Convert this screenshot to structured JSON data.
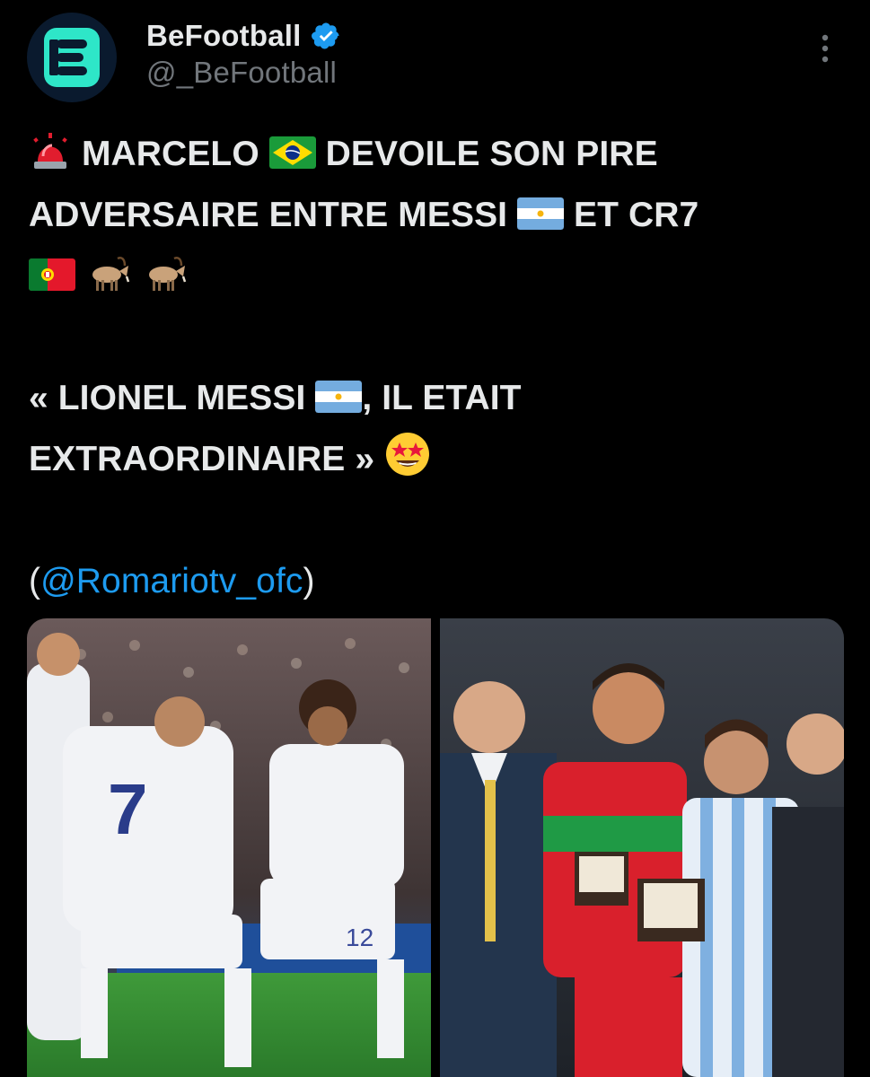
{
  "account": {
    "display_name": "BeFootball",
    "handle": "@_BeFootball",
    "verified": true,
    "avatar_icon": "befootball-logo",
    "brand_color": "#2ee6c8"
  },
  "header": {
    "more_icon": "more-vertical-icon"
  },
  "post": {
    "line1_a": "MARCELO",
    "line1_b": "DEVOILE SON PIRE",
    "line2_a": "ADVERSAIRE ENTRE MESSI",
    "line2_b": "ET CR7",
    "quote_line1_a": "« LIONEL MESSI",
    "quote_line1_b": ", IL ETAIT",
    "quote_line2": "EXTRAORDINAIRE »",
    "mention_open": "(",
    "mention": "@Romariotv_ofc",
    "mention_close": ")",
    "emojis": [
      "siren",
      "flag-brazil",
      "flag-argentina",
      "flag-portugal",
      "goat",
      "goat",
      "flag-argentina",
      "star-struck"
    ]
  },
  "media": {
    "image_count": 2
  },
  "colors": {
    "background": "#000000",
    "text": "#e7e9ea",
    "secondary": "#71767b",
    "link": "#1d9bf0",
    "verified": "#1d9bf0"
  }
}
